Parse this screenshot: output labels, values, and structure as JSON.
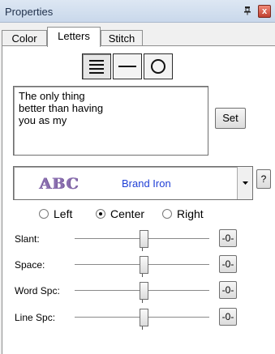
{
  "window": {
    "title": "Properties",
    "pin_glyph": "q",
    "close_glyph": "x"
  },
  "tabs": [
    {
      "label": "Color"
    },
    {
      "label": "Letters"
    },
    {
      "label": "Stitch"
    }
  ],
  "active_tab": "Letters",
  "alignment_icons": [
    "lines-icon",
    "line-icon",
    "circle-icon"
  ],
  "text": {
    "value": "The only thing\nbetter than having\nyou as my"
  },
  "set_button": {
    "label": "Set"
  },
  "font": {
    "preview": "ABC",
    "name": "Brand Iron",
    "preview_color": "#8b6fb0",
    "name_color": "#1f3fd6"
  },
  "help_button": {
    "label": "?"
  },
  "justify": {
    "options": [
      "Left",
      "Center",
      "Right"
    ],
    "selected": "Center"
  },
  "sliders": [
    {
      "label": "Slant:",
      "reset": "-0-",
      "value_fraction": 0.5
    },
    {
      "label": "Space:",
      "reset": "-0-",
      "value_fraction": 0.5
    },
    {
      "label": "Word Spc:",
      "reset": "-0-",
      "value_fraction": 0.5
    },
    {
      "label": "Line Spc:",
      "reset": "-0-",
      "value_fraction": 0.5
    }
  ]
}
